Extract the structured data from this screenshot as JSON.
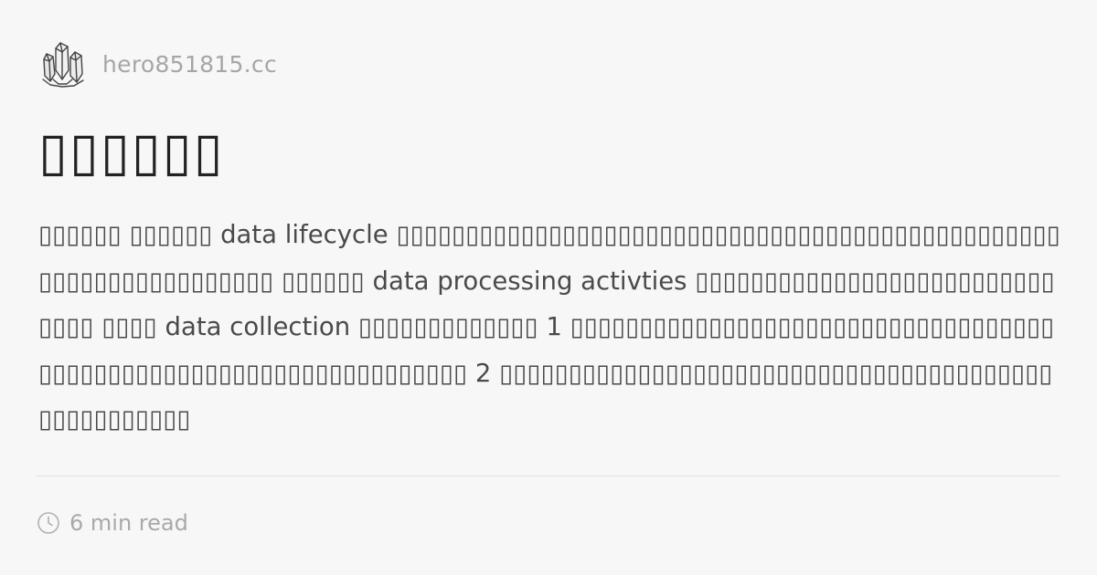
{
  "site": {
    "name": "hero851815.cc",
    "logo_icon": "crystal-logo-icon"
  },
  "post": {
    "title": "▯▯▯▯▯▯",
    "excerpt": "▯▯▯▯▯▯ ▯▯▯▯▯▯ data lifecycle ▯▯▯▯▯▯▯▯▯▯▯▯▯▯▯▯▯▯▯▯▯▯▯▯▯▯▯▯▯▯▯▯▯▯▯▯▯▯▯▯▯▯▯▯▯▯▯▯▯▯▯▯▯▯▯▯▯▯▯▯▯▯▯▯▯ ▯▯▯▯▯▯ data processing activties ▯▯▯▯▯▯▯▯▯▯▯▯▯▯▯▯▯▯▯▯▯▯▯▯▯▯▯▯▯▯ ▯▯▯▯ data collection ▯▯▯▯▯▯▯▯▯▯▯▯▯ 1 ▯▯▯▯▯▯▯▯▯▯▯▯▯▯▯▯▯▯▯▯▯▯▯▯▯▯▯▯▯▯▯▯▯▯▯▯▯▯▯▯▯▯▯▯▯▯▯▯▯▯▯▯▯▯▯▯▯▯▯▯▯▯▯▯▯▯ 2 ▯▯▯▯▯▯▯▯▯▯▯▯▯▯▯▯▯▯▯▯▯▯▯▯▯▯▯▯▯▯▯▯▯▯▯▯▯▯▯▯▯▯▯▯▯▯▯▯▯▯▯",
    "read_time": "6 min read",
    "clock_icon": "clock-icon"
  },
  "colors": {
    "background": "#f8f7f8",
    "title": "#222222",
    "excerpt": "#4a4a4a",
    "muted": "#a6a6a6",
    "divider": "#e3e2e4"
  }
}
